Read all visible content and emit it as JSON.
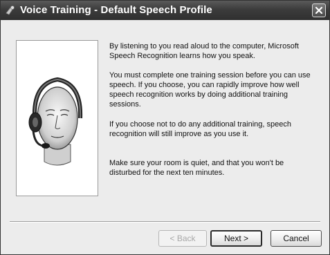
{
  "window": {
    "title": "Voice Training - Default Speech Profile"
  },
  "content": {
    "paragraphs": [
      "By listening to you read aloud to the computer, Microsoft Speech Recognition learns how you speak.",
      "You must complete one training session before you can use speech.  If you choose, you can rapidly improve how well speech recognition works by doing additional training sessions.",
      "If you choose not to do any additional training, speech recognition will still improve as you use it.",
      "Make sure your room is quiet, and that you won't be disturbed for the next ten minutes."
    ]
  },
  "buttons": {
    "back": "< Back",
    "next": "Next >",
    "cancel": "Cancel"
  }
}
